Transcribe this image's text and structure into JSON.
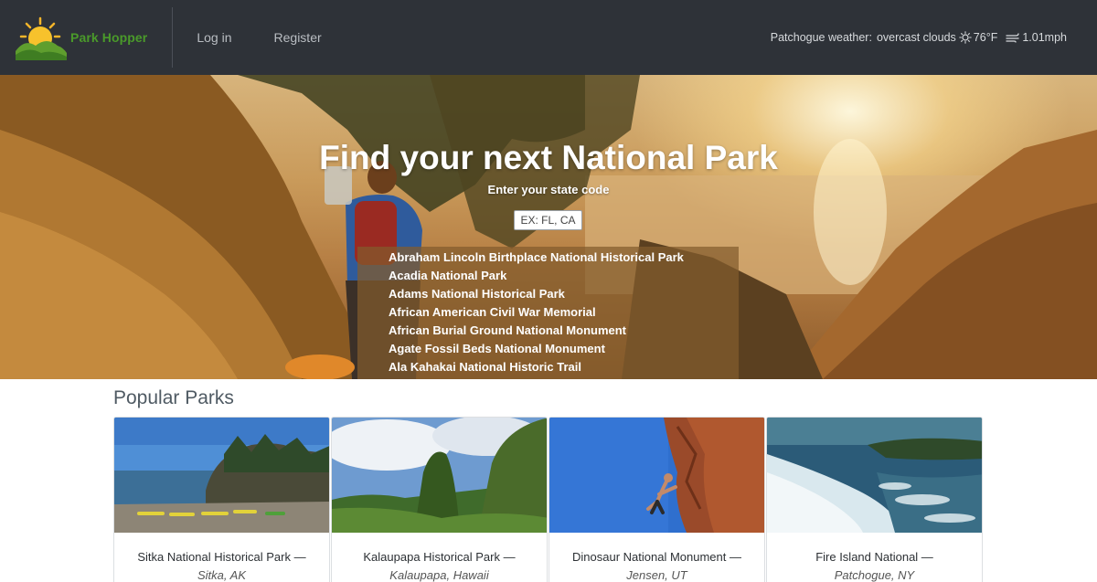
{
  "navbar": {
    "brand_name": "Park Hopper",
    "login_label": "Log in",
    "register_label": "Register",
    "weather": {
      "label": "Patchogue weather:",
      "condition": "overcast clouds",
      "condition_icon": "sun-icon",
      "temperature": "76°F",
      "wind_icon": "wind-icon",
      "wind_speed": "1.01mph"
    }
  },
  "hero": {
    "title": "Find your next National Park",
    "subtitle": "Enter your state code",
    "input_placeholder": "EX: FL, CA",
    "suggestions": [
      "Abraham Lincoln Birthplace National Historical Park",
      "Acadia National Park",
      "Adams National Historical Park",
      "African American Civil War Memorial",
      "African Burial Ground National Monument",
      "Agate Fossil Beds National Monument",
      "Ala Kahakai National Historic Trail"
    ]
  },
  "popular": {
    "title": "Popular Parks",
    "parks": [
      {
        "name": "Sitka National Historical Park —",
        "location": "Sitka, AK"
      },
      {
        "name": "Kalaupapa Historical Park —",
        "location": "Kalaupapa, Hawaii"
      },
      {
        "name": "Dinosaur National Monument —",
        "location": "Jensen, UT"
      },
      {
        "name": "Fire Island National —",
        "location": "Patchogue, NY"
      }
    ]
  },
  "colors": {
    "navbar_bg": "#2e3238",
    "brand_green": "#4a9a2a",
    "suggestion_bg": "rgba(130,92,45,0.72)"
  }
}
